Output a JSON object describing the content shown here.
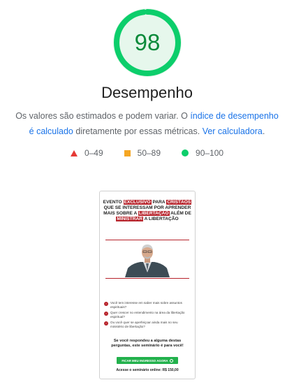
{
  "score": {
    "value": "98",
    "fraction": 0.98,
    "arc_color": "#0cce6b",
    "track_color": "#e6f7ec",
    "text_color": "#0a8a3a"
  },
  "title": "Desempenho",
  "description": {
    "text1": "Os valores são estimados e podem variar. O ",
    "link1": "índice de desempenho é calculado",
    "text2": " diretamente por essas métricas. ",
    "link2": "Ver calculadora",
    "text3": "."
  },
  "legend": [
    {
      "range": "0–49",
      "icon": "red-triangle-icon",
      "color": "#e53935"
    },
    {
      "range": "50–89",
      "icon": "orange-square-icon",
      "color": "#f5a623"
    },
    {
      "range": "90–100",
      "icon": "green-circle-icon",
      "color": "#0cce6b"
    }
  ],
  "thumbnail": {
    "headline": {
      "p1": "EVENTO ",
      "h1": "EXCLUSIVO",
      "p2": " PARA ",
      "h2": "CRISTÃOS",
      "p3": " QUE SE INTERESSAM POR APRENDER MAIS SOBRE A ",
      "h3": "LIBERTAÇÃO",
      "p4": " ALÉM DE ",
      "h4": "MINISTRAR",
      "p5": " A LIBERTAÇÃO"
    },
    "bullets": [
      "Você tem interesse em saber mais sobre assuntos espirituais?",
      "Quer crescer no entendimento na área da libertação espiritual?",
      "Ou você quer se aperfeiçoar ainda mais no seu ministério de libertação?"
    ],
    "closing": "Se você respondeu a alguma destas perguntas, este seminário é para você!",
    "cta": "FICAR MEU INGRESSO AGORA",
    "price": "Acesse o seminário online: R$ 150,00"
  }
}
